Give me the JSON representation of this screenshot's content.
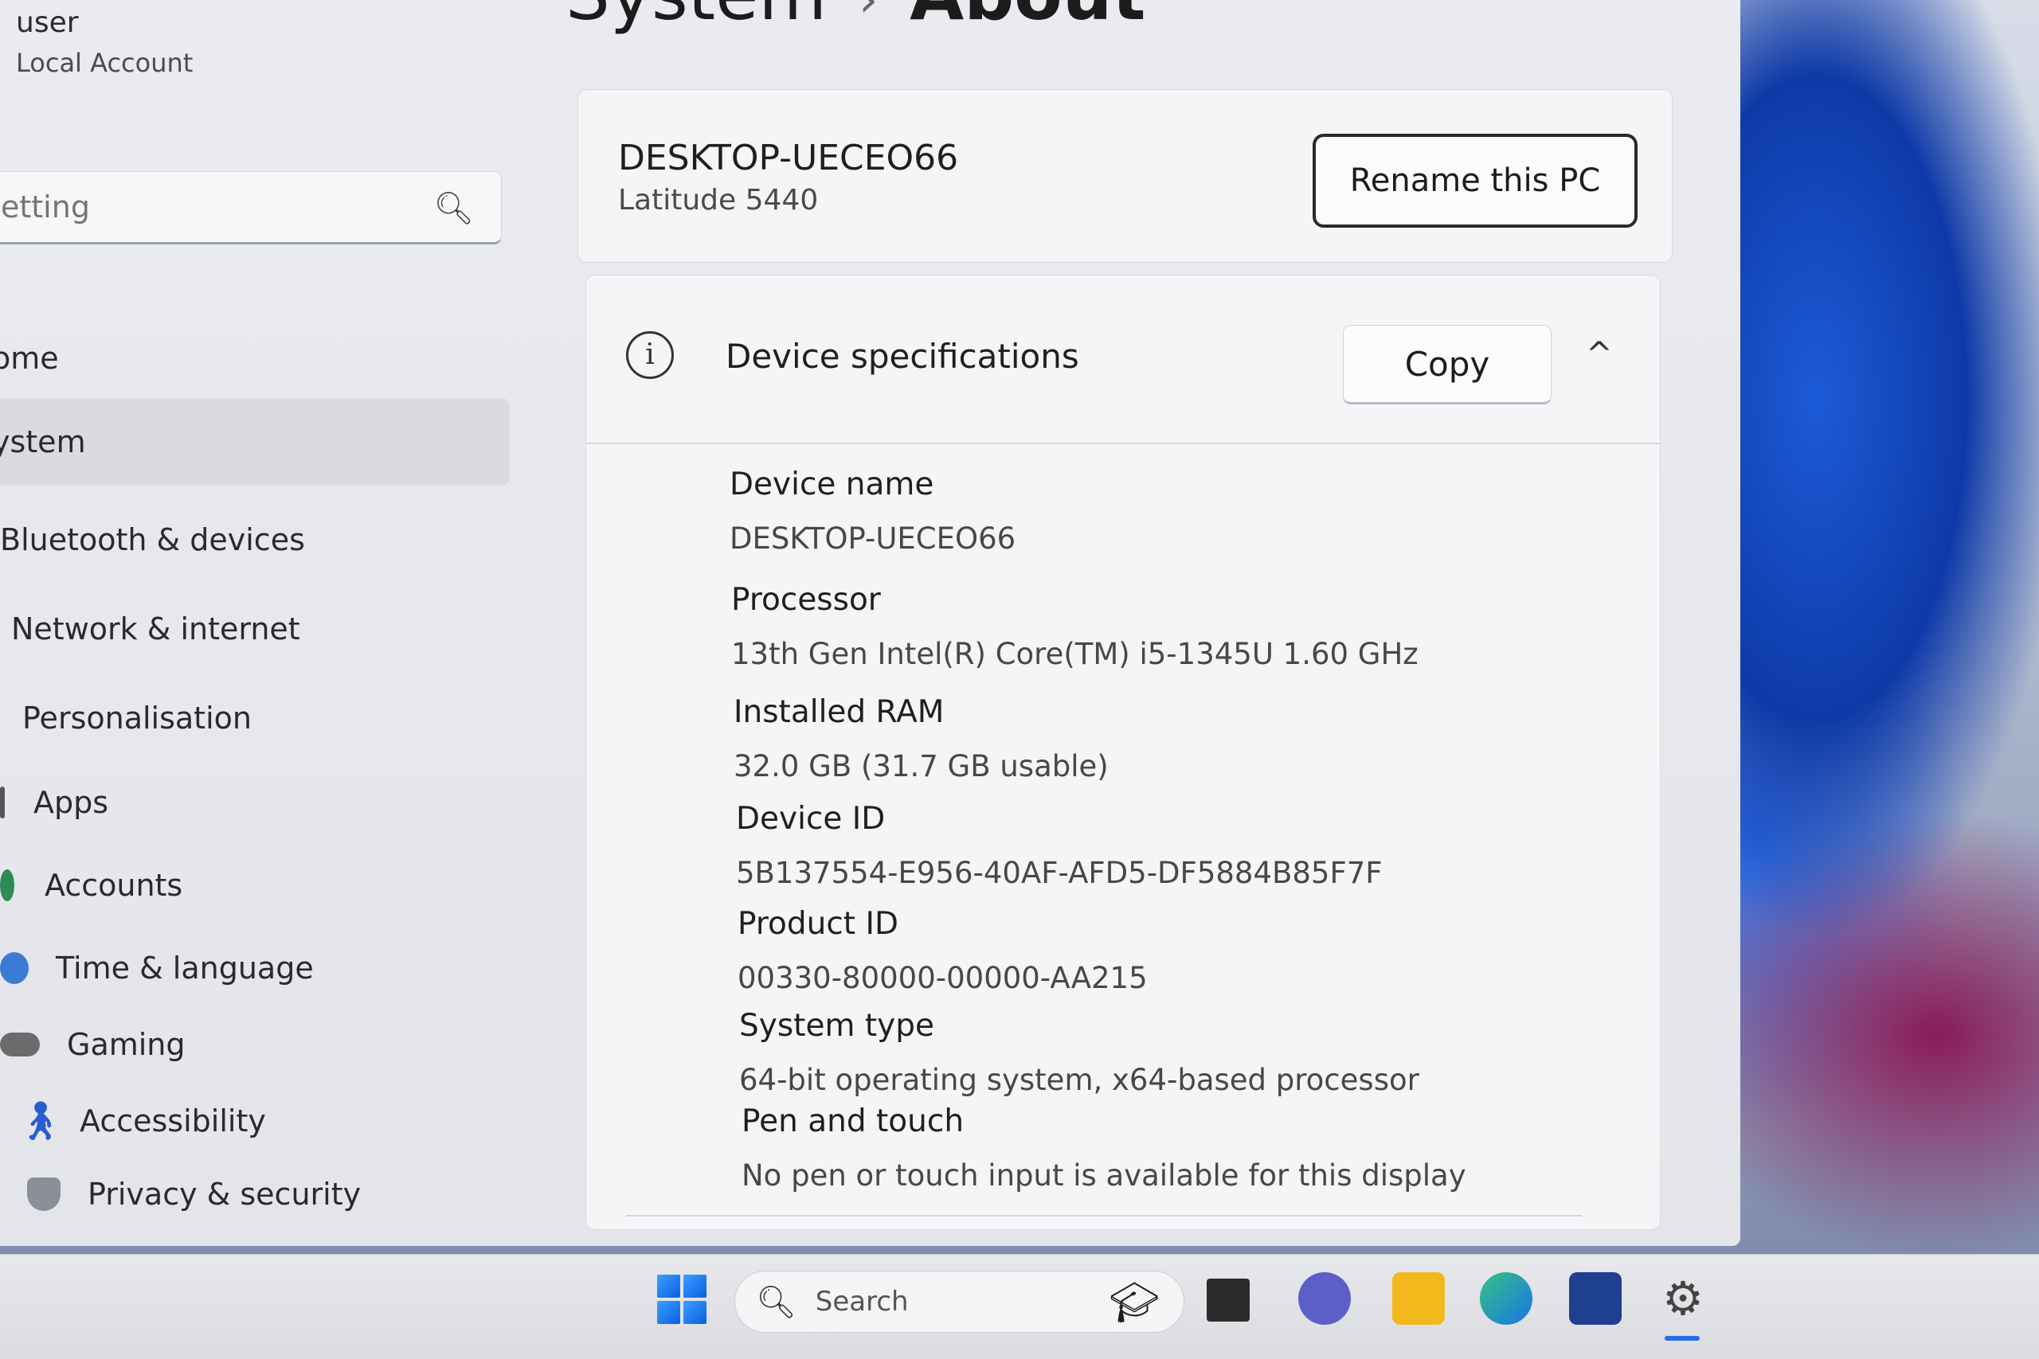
{
  "account": {
    "name": "user",
    "type": "Local Account"
  },
  "sidebar": {
    "search_placeholder": "etting",
    "items": [
      {
        "label": "ome",
        "selected": false
      },
      {
        "label": "ystem",
        "selected": true
      },
      {
        "label": "Bluetooth & devices",
        "selected": false
      },
      {
        "label": "Network & internet",
        "selected": false
      },
      {
        "label": "Personalisation",
        "selected": false
      },
      {
        "label": "Apps",
        "selected": false
      },
      {
        "label": "Accounts",
        "selected": false
      },
      {
        "label": "Time & language",
        "selected": false
      },
      {
        "label": "Gaming",
        "selected": false
      },
      {
        "label": "Accessibility",
        "selected": false
      },
      {
        "label": "Privacy & security",
        "selected": false
      }
    ]
  },
  "header": {
    "section": "System",
    "separator": "›",
    "page": "About"
  },
  "device_card": {
    "name": "DESKTOP-UECEO66",
    "model": "Latitude 5440",
    "rename_label": "Rename this PC"
  },
  "specs": {
    "title": "Device specifications",
    "copy_label": "Copy",
    "chevron": "^",
    "rows": [
      {
        "label": "Device name",
        "value": "DESKTOP-UECEO66"
      },
      {
        "label": "Processor",
        "value": "13th Gen Intel(R) Core(TM) i5-1345U   1.60 GHz"
      },
      {
        "label": "Installed RAM",
        "value": "32.0 GB (31.7 GB usable)"
      },
      {
        "label": "Device ID",
        "value": "5B137554-E956-40AF-AFD5-DF5884B85F7F"
      },
      {
        "label": "Product ID",
        "value": "00330-80000-00000-AA215"
      },
      {
        "label": "System type",
        "value": "64-bit operating system, x64-based processor"
      },
      {
        "label": "Pen and touch",
        "value": "No pen or touch input is available for this display"
      }
    ]
  },
  "taskbar": {
    "search_label": "Search"
  },
  "colors": {
    "accent": "#2a6ae8",
    "window_bg": "#e9ebf0",
    "card_bg": "#f4f5f7"
  },
  "icons": [
    "search-icon",
    "info-icon",
    "chevron-up-icon",
    "windows-start-icon",
    "task-view-icon",
    "teams-chat-icon",
    "file-explorer-icon",
    "edge-icon",
    "store-icon",
    "settings-icon"
  ]
}
